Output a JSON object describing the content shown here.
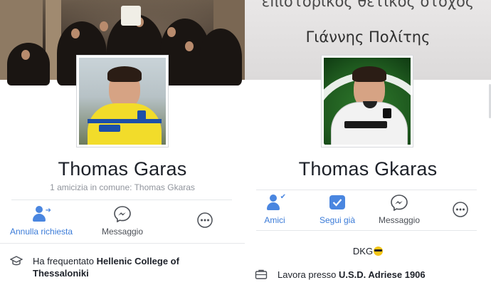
{
  "left": {
    "name": "Thomas Garas",
    "mutual_friends": "1 amicizia in comune: Thomas Gkaras",
    "actions": {
      "cancel_request": "Annulla richiesta",
      "message": "Messaggio"
    },
    "info": {
      "prefix": "Ha frequentato ",
      "school": "Hellenic College of Thessaloniki"
    }
  },
  "right": {
    "cover_top_text": "επιστορικός θετικός οτόχος",
    "cover_name": "Γιάννης Πολίτης",
    "name": "Thomas Gkaras",
    "actions": {
      "friends": "Amici",
      "following": "Segui già",
      "message": "Messaggio"
    },
    "bio": "DKG",
    "work": {
      "prefix": "Lavora presso ",
      "employer": "U.S.D. Adriese 1906"
    }
  },
  "colors": {
    "accent": "#3b7bd8",
    "text": "#1d2129",
    "muted": "#90949c",
    "divider": "#e5e7ea"
  },
  "icons": [
    "person-arrow-icon",
    "messenger-icon",
    "more-icon",
    "person-check-icon",
    "follow-check-icon",
    "school-icon",
    "briefcase-icon"
  ]
}
